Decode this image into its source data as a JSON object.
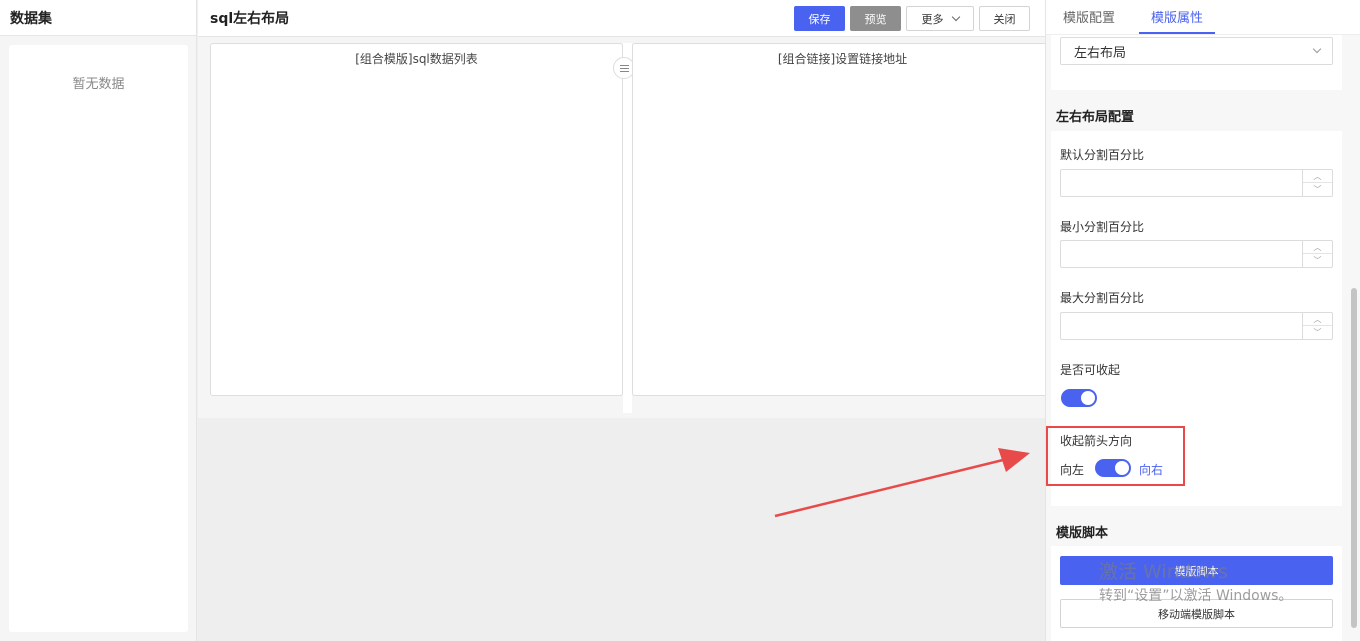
{
  "left_panel": {
    "title": "数据集",
    "empty_text": "暂无数据"
  },
  "editor": {
    "title": "sql左右布局",
    "toolbar": {
      "save": "保存",
      "preview": "预览",
      "more": "更多",
      "close": "关闭"
    },
    "panes": [
      {
        "title": "[组合模版]sql数据列表"
      },
      {
        "title": "[组合链接]设置链接地址"
      }
    ]
  },
  "right_panel": {
    "tabs": [
      "模版配置",
      "模版属性"
    ],
    "active_tab": "模版属性",
    "layout_select": {
      "value": "左右布局"
    },
    "config_section": "左右布局配置",
    "fields": {
      "default_percent": {
        "label": "默认分割百分比",
        "value": ""
      },
      "min_percent": {
        "label": "最小分割百分比",
        "value": ""
      },
      "max_percent": {
        "label": "最大分割百分比",
        "value": ""
      },
      "collapsible": {
        "label": "是否可收起",
        "on": true
      },
      "arrow_direction": {
        "label": "收起箭头方向",
        "left_label": "向左",
        "right_label": "向右",
        "on": true
      }
    },
    "script_section": "模版脚本",
    "script_buttons": {
      "template_script": "模版脚本",
      "mobile_script": "移动端模版脚本"
    }
  },
  "watermark": {
    "line1": "激活 Windows",
    "line2": "转到“设置”以激活 Windows。"
  },
  "colors": {
    "primary": "#4a62f0",
    "annotation": "#e84a4a"
  }
}
